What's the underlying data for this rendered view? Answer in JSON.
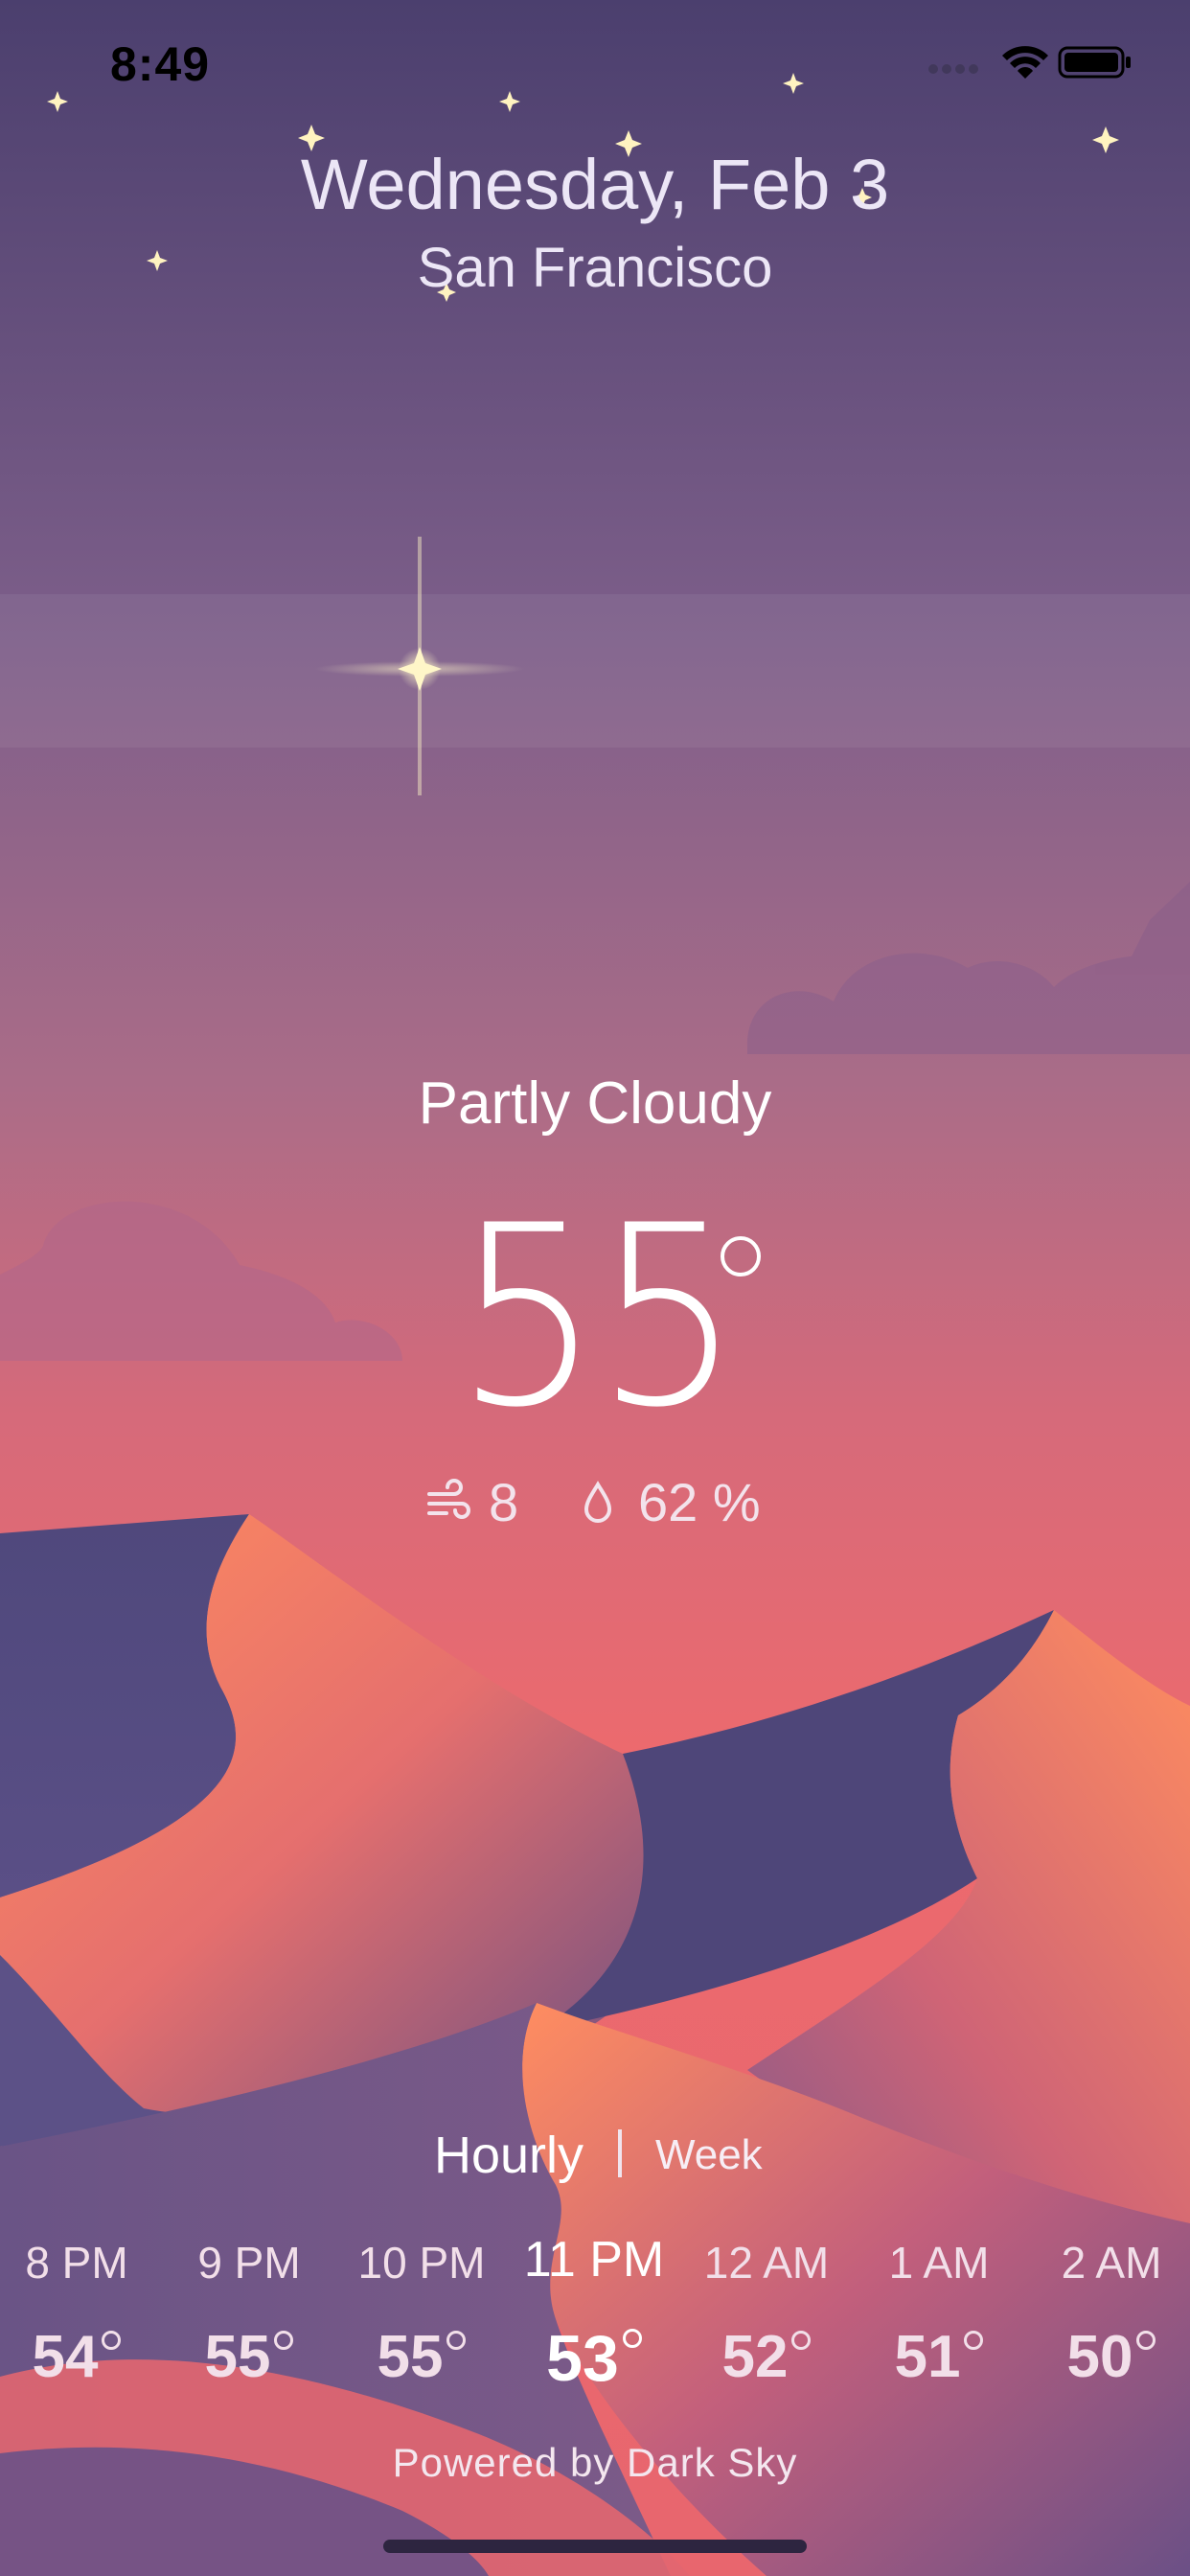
{
  "status_bar": {
    "time": "8:49"
  },
  "header": {
    "date": "Wednesday, Feb 3",
    "city": "San Francisco"
  },
  "current": {
    "condition": "Partly Cloudy",
    "temperature": "55",
    "wind": "8",
    "humidity": "62 %"
  },
  "tabs": {
    "hourly": "Hourly",
    "week": "Week",
    "selected": "Hourly"
  },
  "hourly": [
    {
      "time": "8 PM",
      "temp": "54"
    },
    {
      "time": "9 PM",
      "temp": "55"
    },
    {
      "time": "10 PM",
      "temp": "55"
    },
    {
      "time": "11 PM",
      "temp": "53",
      "current": true
    },
    {
      "time": "12 AM",
      "temp": "52"
    },
    {
      "time": "1 AM",
      "temp": "51"
    },
    {
      "time": "2 AM",
      "temp": "50"
    }
  ],
  "footer": {
    "powered_by": "Powered by Dark Sky"
  },
  "colors": {
    "sky_top": "#4b3f6e",
    "sky_mid": "#93658b",
    "sky_low": "#e86870",
    "dune_orange": "#ff8a5e",
    "dune_purple": "#4c4678"
  }
}
